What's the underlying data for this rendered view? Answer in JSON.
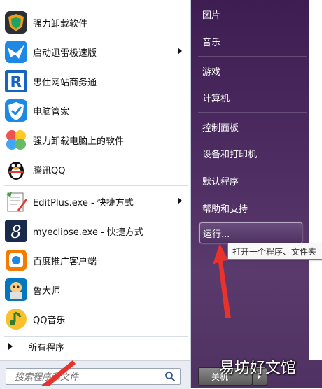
{
  "left_panel": {
    "items": [
      {
        "label": "强力卸载软件",
        "icon": "shield-uninstall-icon",
        "submenu": false
      },
      {
        "label": "启动迅雷极速版",
        "icon": "thunder-bird-icon",
        "submenu": true
      },
      {
        "label": "忠仕网站商务通",
        "icon": "r-logo-icon",
        "submenu": false
      },
      {
        "label": "电脑管家",
        "icon": "shield-check-icon",
        "submenu": false
      },
      {
        "label": "强力卸载电脑上的软件",
        "icon": "colorful-petals-icon",
        "submenu": false
      },
      {
        "label": "腾讯QQ",
        "icon": "qq-penguin-icon",
        "submenu": false
      },
      {
        "label": "EditPlus.exe - 快捷方式",
        "icon": "editplus-icon",
        "submenu": true
      },
      {
        "label": "myeclipse.exe - 快捷方式",
        "icon": "myeclipse-icon",
        "submenu": false
      },
      {
        "label": "百度推广客户端",
        "icon": "baidu-promo-icon",
        "submenu": false
      },
      {
        "label": "鲁大师",
        "icon": "ludashi-icon",
        "submenu": false
      },
      {
        "label": "QQ音乐",
        "icon": "qq-music-icon",
        "submenu": false
      }
    ],
    "all_programs": "所有程序",
    "search_placeholder": "搜索程序和文件"
  },
  "right_panel": {
    "links": [
      "图片",
      "音乐",
      "游戏",
      "计算机",
      "控制面板",
      "设备和打印机",
      "默认程序",
      "帮助和支持"
    ],
    "run_label": "运行...",
    "tooltip": "打开一个程序、文件夹",
    "shutdown_label": "关机"
  },
  "watermark": "易坊好文馆",
  "colors": {
    "accent_purple": "#4a2a5f",
    "annotation_red": "#e8322c"
  }
}
